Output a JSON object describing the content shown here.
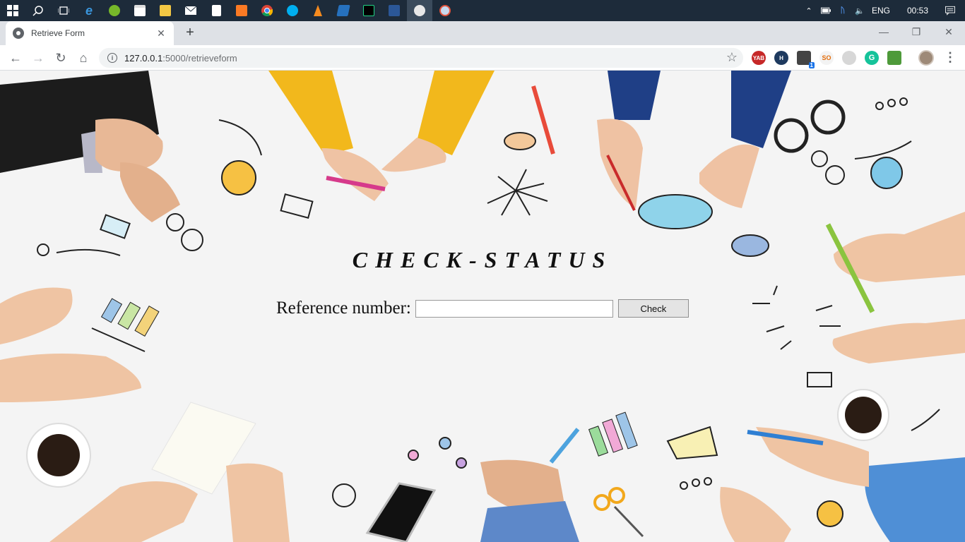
{
  "taskbar": {
    "apps": [
      "start-icon",
      "search-icon",
      "task-view-icon",
      "edge-icon",
      "utorrent-icon",
      "store-icon",
      "file-explorer-icon",
      "mail-icon",
      "document-icon",
      "xampp-icon",
      "chrome-icon",
      "skype-icon",
      "vlc-icon",
      "powershell-icon",
      "pycharm-icon",
      "word-icon",
      "active-app-icon",
      "paint-icon"
    ],
    "tray": {
      "language": "ENG",
      "time": "00:53"
    }
  },
  "browser": {
    "tab_title": "Retrieve Form",
    "new_tab": "+",
    "url_host": "127.0.0.1",
    "url_path": ":5000/retrieveform",
    "extensions": {
      "yab": "YAB",
      "h": "H",
      "badge": "1",
      "so": "SO",
      "g": "G"
    }
  },
  "page": {
    "heading": "CHECK-STATUS",
    "ref_label": "Reference number:",
    "ref_value": "",
    "check_button": "Check"
  }
}
